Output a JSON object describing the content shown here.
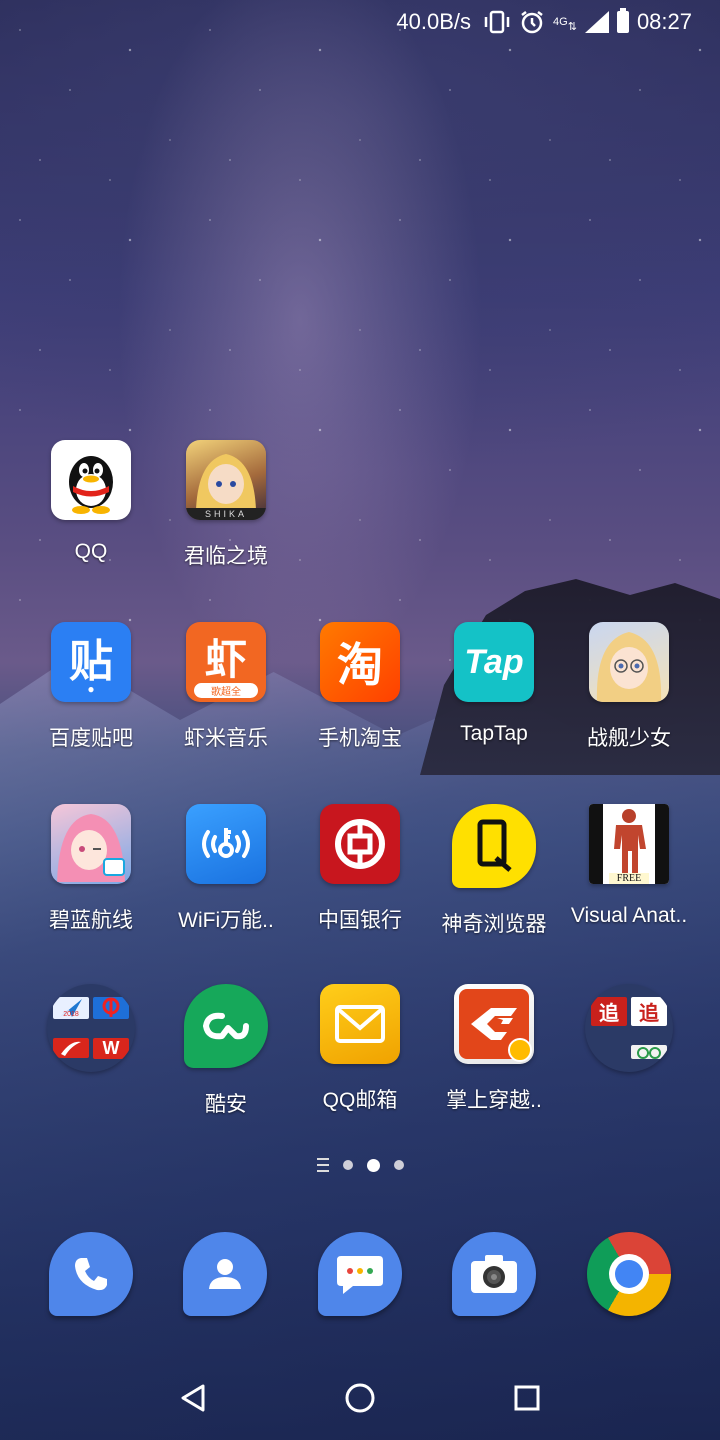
{
  "status_bar": {
    "speed": "40.0B/s",
    "network": "4G",
    "time": "08:27"
  },
  "apps": {
    "qq": {
      "label": "QQ"
    },
    "junlin": {
      "label": "君临之境",
      "badge_text": "SHIKA"
    },
    "tieba": {
      "label": "百度贴吧",
      "glyph": "贴"
    },
    "xiami": {
      "label": "虾米音乐",
      "glyph": "虾",
      "sub": "歌超全"
    },
    "taobao": {
      "label": "手机淘宝",
      "glyph": "淘"
    },
    "taptap": {
      "label": "TapTap",
      "glyph": "Tap"
    },
    "zhanjian": {
      "label": "战舰少女"
    },
    "bilan": {
      "label": "碧蓝航线"
    },
    "wifi": {
      "label": "WiFi万能.."
    },
    "boc": {
      "label": "中国银行"
    },
    "shenqi": {
      "label": "神奇浏览器"
    },
    "anatomy": {
      "label": "Visual Anat..",
      "badge_text": "FREE"
    },
    "folder1": {
      "label": "",
      "mini_badge": "2018"
    },
    "kuan": {
      "label": "酷安"
    },
    "qqmail": {
      "label": "QQ邮箱"
    },
    "cf": {
      "label": "掌上穿越.."
    },
    "folder2": {
      "label": "",
      "glyph_a": "追",
      "glyph_b": "追"
    }
  },
  "page_indicator": {
    "count": 3,
    "active_index": 1
  },
  "dock": [
    "phone",
    "contacts",
    "messages",
    "camera",
    "chrome"
  ],
  "colors": {
    "tieba": "#2b7ff3",
    "xiami": "#f26722",
    "taobao": "#ff5000",
    "taptap": "#14c2c7",
    "wifi": "#2a8cf0",
    "boc": "#c8161e",
    "shenqi": "#ffe000",
    "kuan": "#16a85a",
    "qqmail": "#f8b800",
    "dock_blue": "#4f86ea"
  }
}
